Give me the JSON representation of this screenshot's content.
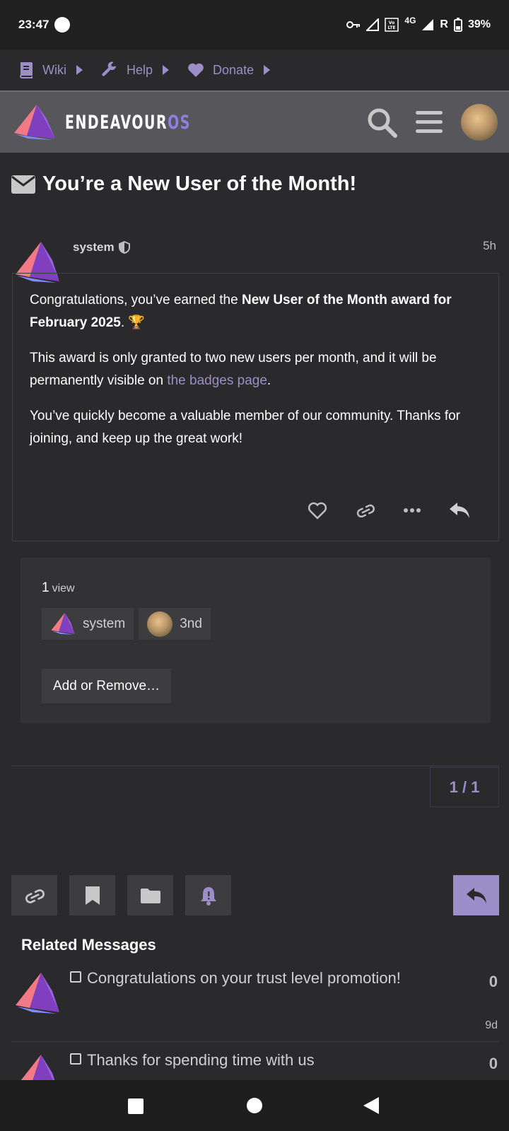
{
  "status_bar": {
    "time": "23:47",
    "network": "4G",
    "roaming": "R",
    "battery": "39%"
  },
  "top_nav": {
    "links": [
      {
        "label": "Wiki",
        "icon": "book-icon"
      },
      {
        "label": "Help",
        "icon": "wrench-icon"
      },
      {
        "label": "Donate",
        "icon": "heart-icon"
      }
    ]
  },
  "header": {
    "logo_text": "ENDEAVOUR",
    "logo_suffix": "OS",
    "icons": [
      "search-icon",
      "menu-icon",
      "user-avatar"
    ]
  },
  "topic": {
    "title": "You’re a New User of the Month!",
    "icon": "envelope-icon"
  },
  "post": {
    "author": "system",
    "age": "5h",
    "p1_pre": "Congratulations, you’ve earned the ",
    "p1_bold": "New User of the Month award for February 2025",
    "p1_post": ". 🏆",
    "p2_pre": "This award is only granted to two new users per month, and it will be permanently visible on ",
    "p2_link": "the badges page",
    "p2_post": ".",
    "p3": "You’ve quickly become a valuable member of our community. Thanks for joining, and keep up the great work!"
  },
  "views": {
    "count": "1",
    "label": "view",
    "participants": [
      {
        "name": "system"
      },
      {
        "name": "3nd"
      }
    ],
    "add_remove_label": "Add or Remove…"
  },
  "pager": {
    "text": "1 / 1"
  },
  "footer_buttons": [
    "link-icon",
    "bookmark-icon",
    "folder-icon",
    "bell-icon",
    "reply-icon"
  ],
  "related": {
    "title": "Related Messages",
    "items": [
      {
        "title": "Congratulations on your trust level promotion!",
        "count": "0",
        "age": "9d"
      },
      {
        "title": "Thanks for spending time with us",
        "count": "0",
        "age": ""
      }
    ]
  },
  "colors": {
    "accent": "#9b8ec9",
    "background": "#2a292b",
    "header": "#57565a"
  }
}
